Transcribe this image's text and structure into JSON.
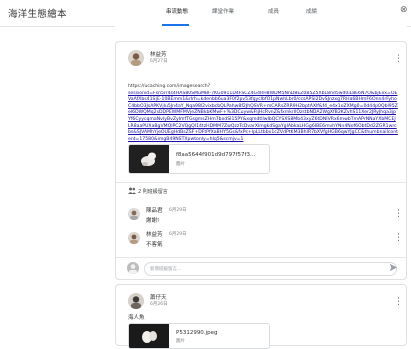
{
  "header": {
    "app_title": "海洋生態繪本",
    "tabs": [
      {
        "label": "串流動態",
        "active": true
      },
      {
        "label": "課堂作業",
        "active": false
      },
      {
        "label": "成員",
        "active": false
      },
      {
        "label": "成績",
        "active": false
      }
    ],
    "close_glyph": "⊗"
  },
  "post1": {
    "author": "林益芳",
    "time": "6月27日",
    "more_glyph": "⋮",
    "link_first_line": "https://ucaching.com/imagesearch?",
    "link_text": "sessionid=Fsn5rr4s4HAS80SMuMBI-7KG0911D4FSCZ4G4RH8WDM5NnD8EZ0B5Z5XbL8nd5wd0iL8E6N7O&bjExx=OEVaAfXbs41S|E-10BEmm1&rIrh=kdenbb6ua3F0f2pv53fqyclbfO1pNwhLbr0/ccsAPSI2DvSJnzxg7RHa6BHmF6Onn4rFyhoC4bbO3JsAPKVjIu5Jn4aY_Nqa98l2vixbcbQLPahw8f2JhQSVR+mCARsZRR9H2bptAXlf&f4_e4x1oZXMg0=0d44p0Qbl95ZeI6DWQMq2sDDPEWMFMVjeZNBkbKMwF+%3DCuyw&FIjHcRvnZ&fxmkrllOzstbNDA2WgXfB2KZvhS11Xer2JRyJhqa3jpYf6CyycqmaNvIyBvZyImfTGsgmsZHm7bxdSI15PY&xqmdtllwIbQCYSXS8Mb43xyZ6tDNIVRx6mwbTmAPrNNaYXbMCEJLR8aaPUXaBgVMQIPC2VQgQI14tzHDMM7ZwQzzTcDvarXlmgkdSgaYglAbkaLHGg6IBE6mvhYNn4Nof6ObtDd2ZGR1wrcbs&SJVAMhYjeOUEgHdBsZSF+DFtPfXaBHY5Gs&fxPs+lpLLtbbx1cZVdPtKM3BhIR7bXVfgHGB6qwYJgCC&thumbnailcontent=17580&imgB49NSTXpwtonly=hIq5&scmjv=1",
    "attachment": {
      "name": "f8aa5644f901d9d797f57f3...",
      "type": "圖片"
    },
    "comments_header": "2 則班級留言",
    "comments": [
      {
        "author": "陳品君",
        "time": "6月29日",
        "text": "謝謝!"
      },
      {
        "author": "林益芳",
        "time": "6月29日",
        "text": "不客氣"
      }
    ],
    "reply_placeholder": "新增班級留言..."
  },
  "post2": {
    "author": "蕭仔天",
    "time": "6月26日",
    "more_glyph": "⋮",
    "label": "海人魚",
    "attachment": {
      "name": "P5312990.jpeg",
      "type": "圖片"
    }
  },
  "colors": {
    "accent": "#1a73e8",
    "link": "#1a0dab"
  },
  "icons": [
    "close-icon",
    "more-vert-icon",
    "people-icon",
    "send-icon",
    "avatar-icon"
  ]
}
